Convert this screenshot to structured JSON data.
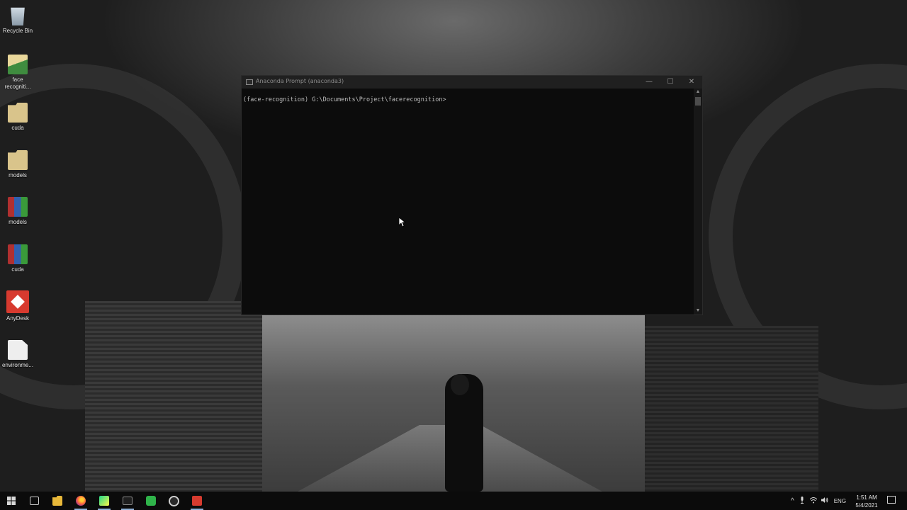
{
  "desktop": {
    "icons": [
      {
        "label": "Recycle Bin",
        "icon": "recycle-bin-icon"
      },
      {
        "label": "face recogniti...",
        "icon": "folder-archive-icon"
      },
      {
        "label": "cuda",
        "icon": "folder-icon"
      },
      {
        "label": "models",
        "icon": "folder-icon"
      },
      {
        "label": "models",
        "icon": "winrar-archive-icon"
      },
      {
        "label": "cuda",
        "icon": "winrar-archive-icon"
      },
      {
        "label": "AnyDesk",
        "icon": "anydesk-icon"
      },
      {
        "label": "environme...",
        "icon": "file-icon"
      }
    ]
  },
  "console": {
    "title": "Anaconda Prompt (anaconda3)",
    "prompt_line": "(face-recognition) G:\\Documents\\Project\\facerecognition>",
    "minimize": "—",
    "maximize": "☐",
    "close": "✕"
  },
  "taskbar": {
    "apps": [
      "start-icon",
      "task-view-icon",
      "file-explorer-icon",
      "firefox-icon",
      "pycharm-icon",
      "terminal-icon",
      "camtasia-icon",
      "obs-icon",
      "camtasia-recorder-icon"
    ],
    "language": "ENG",
    "time": "1:51 AM",
    "date": "5/4/2021"
  },
  "colors": {
    "console_bg": "#0c0c0c",
    "titlebar_bg": "#202020",
    "taskbar_bg": "#0b0b0b"
  }
}
